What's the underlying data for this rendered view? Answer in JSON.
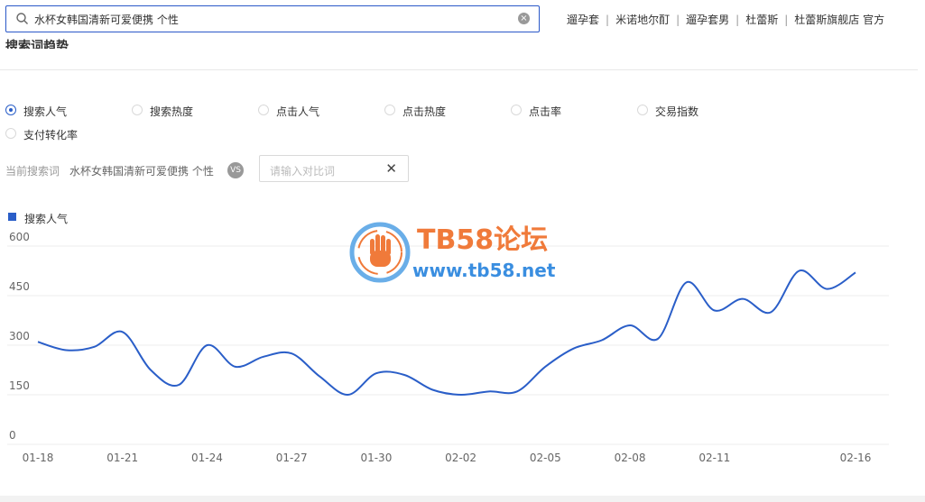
{
  "search": {
    "value": "水杯女韩国清新可爱便携 个性"
  },
  "hot_words": [
    "遛孕套",
    "米诺地尔酊",
    "遛孕套男",
    "杜蕾斯",
    "杜蕾斯旗舰店 官方"
  ],
  "section_title": "搜索词趋势",
  "metrics": [
    {
      "label": "搜索人气",
      "selected": true
    },
    {
      "label": "搜索热度",
      "selected": false
    },
    {
      "label": "点击人气",
      "selected": false
    },
    {
      "label": "点击热度",
      "selected": false
    },
    {
      "label": "点击率",
      "selected": false
    },
    {
      "label": "交易指数",
      "selected": false
    },
    {
      "label": "支付转化率",
      "selected": false
    }
  ],
  "compare": {
    "current_label": "当前搜索词",
    "current_word": "水杯女韩国清新可爱便携 个性",
    "vs_label": "VS",
    "input_placeholder": "请输入对比词"
  },
  "watermark": {
    "title": "TB58论坛",
    "url": "www.tb58.net"
  },
  "colors": {
    "series": "#2a5ec8",
    "accent": "#2a58c8",
    "watermark_orange": "#f07a3a",
    "watermark_blue": "#3a8ee0"
  },
  "chart_data": {
    "type": "line",
    "x": [
      "01-18",
      "01-19",
      "01-20",
      "01-21",
      "01-22",
      "01-23",
      "01-24",
      "01-25",
      "01-26",
      "01-27",
      "01-28",
      "01-29",
      "01-30",
      "01-31",
      "02-01",
      "02-02",
      "02-03",
      "02-04",
      "02-05",
      "02-06",
      "02-07",
      "02-08",
      "02-09",
      "02-10",
      "02-11",
      "02-12",
      "02-13",
      "02-14",
      "02-15",
      "02-16"
    ],
    "x_tick_labels": [
      "01-18",
      "01-21",
      "01-24",
      "01-27",
      "01-30",
      "02-02",
      "02-05",
      "02-08",
      "02-11",
      "02-16"
    ],
    "series": [
      {
        "name": "搜索人气",
        "values": [
          310,
          285,
          295,
          340,
          225,
          180,
          300,
          235,
          265,
          275,
          205,
          150,
          215,
          210,
          165,
          150,
          160,
          160,
          235,
          290,
          315,
          360,
          320,
          490,
          405,
          440,
          400,
          525,
          470,
          520
        ]
      }
    ],
    "ylim": [
      0,
      600
    ],
    "yticks": [
      0,
      150,
      300,
      450,
      600
    ],
    "grid": true,
    "legend_position": "top-left"
  }
}
